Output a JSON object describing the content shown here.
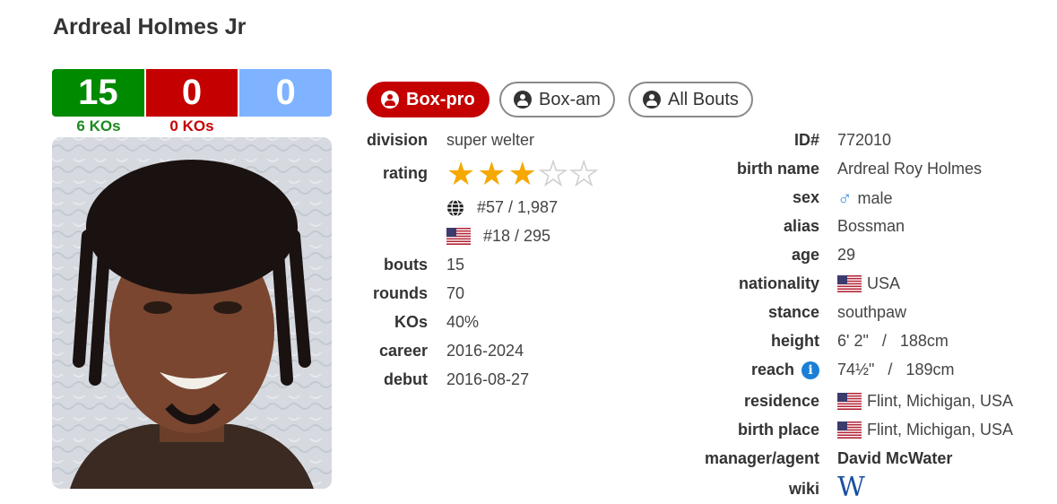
{
  "boxer": {
    "name": "Ardreal Holmes Jr",
    "record": {
      "wins": "15",
      "losses": "0",
      "draws": "0",
      "win_kos": "6 KOs",
      "loss_kos": "0 KOs"
    }
  },
  "tabs": [
    {
      "label": "Box-pro",
      "active": true
    },
    {
      "label": "Box-am",
      "active": false
    },
    {
      "label": "All Bouts",
      "active": false
    }
  ],
  "left_info": {
    "division": {
      "label": "division",
      "value": "super welter"
    },
    "rating": {
      "label": "rating",
      "stars_filled": 3,
      "stars_total": 5
    },
    "world_rank": "#57 / 1,987",
    "country_rank": "#18 / 295",
    "bouts": {
      "label": "bouts",
      "value": "15"
    },
    "rounds": {
      "label": "rounds",
      "value": "70"
    },
    "kos": {
      "label": "KOs",
      "value": "40%"
    },
    "career": {
      "label": "career",
      "value": "2016-2024"
    },
    "debut": {
      "label": "debut",
      "value": "2016-08-27"
    }
  },
  "right_info": {
    "id": {
      "label": "ID#",
      "value": "772010"
    },
    "birth_name": {
      "label": "birth name",
      "value": "Ardreal Roy Holmes"
    },
    "sex": {
      "label": "sex",
      "value": "male",
      "icon": "male-icon"
    },
    "alias": {
      "label": "alias",
      "value": "Bossman"
    },
    "age": {
      "label": "age",
      "value": "29"
    },
    "nationality": {
      "label": "nationality",
      "value": "USA"
    },
    "stance": {
      "label": "stance",
      "value": "southpaw"
    },
    "height": {
      "label": "height",
      "value": "6' 2\"   /   188cm"
    },
    "reach": {
      "label": "reach",
      "value": "74½\"   /   189cm"
    },
    "residence": {
      "label": "residence",
      "value": "Flint, Michigan, USA"
    },
    "birth_place": {
      "label": "birth place",
      "value": "Flint, Michigan, USA"
    },
    "manager": {
      "label": "manager/agent",
      "value": "David McWater"
    },
    "wiki": {
      "label": "wiki",
      "value": "W"
    }
  },
  "colors": {
    "win": "#008a00",
    "loss": "#c40000",
    "draw": "#7fb2ff",
    "accent": "#c40000",
    "star": "#f5a800"
  }
}
